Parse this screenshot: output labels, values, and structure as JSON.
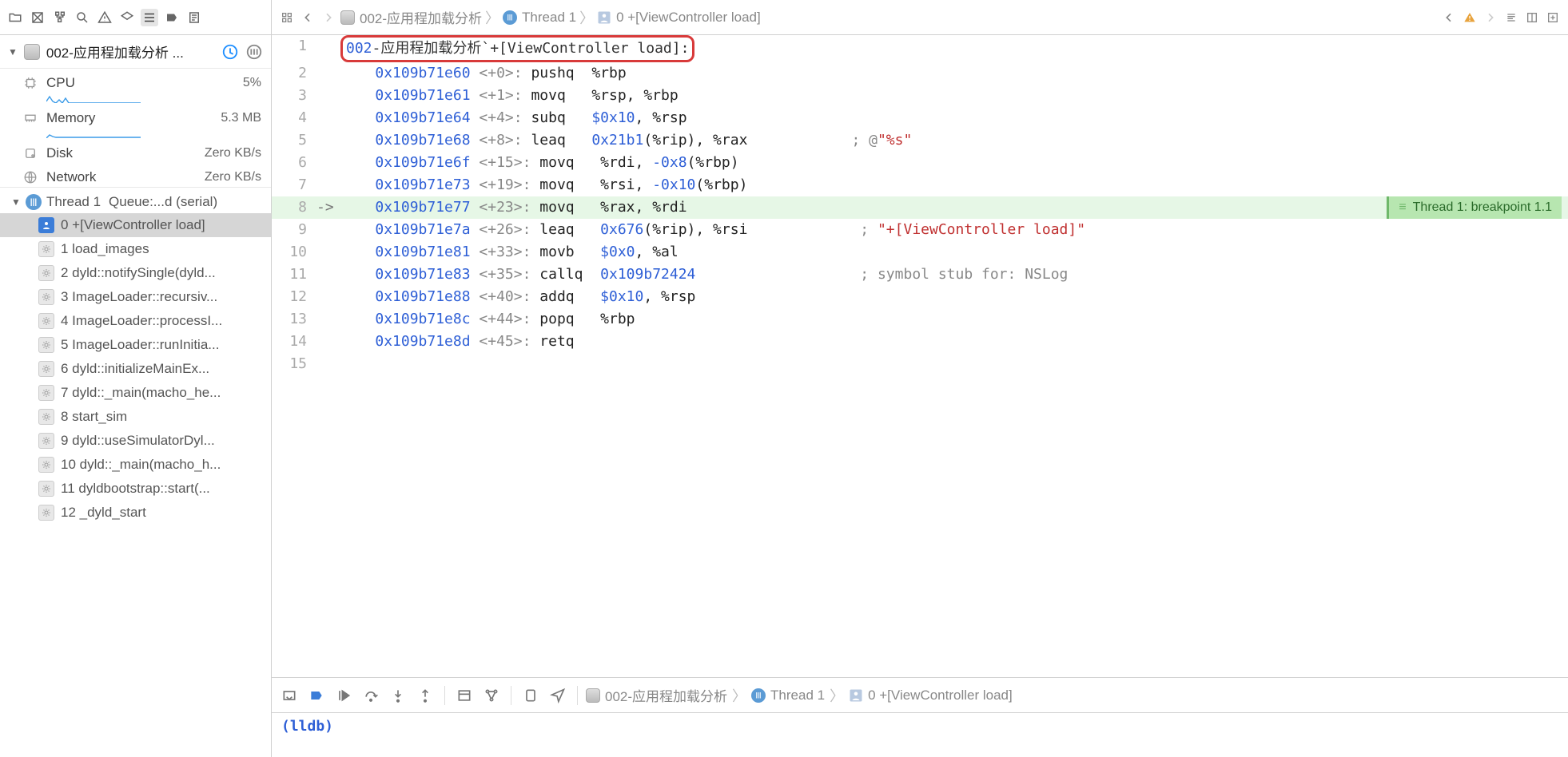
{
  "sidebar": {
    "app_name": "002-应用程加载分析 ...",
    "gauges": {
      "cpu": {
        "label": "CPU",
        "value": "5%"
      },
      "memory": {
        "label": "Memory",
        "value": "5.3 MB"
      },
      "disk": {
        "label": "Disk",
        "value": "Zero KB/s"
      },
      "network": {
        "label": "Network",
        "value": "Zero KB/s"
      }
    },
    "thread": {
      "label": "Thread 1",
      "queue": "Queue:...d (serial)"
    },
    "frames": [
      {
        "n": "0",
        "label": "+[ViewController load]",
        "user": true,
        "selected": true
      },
      {
        "n": "1",
        "label": "load_images"
      },
      {
        "n": "2",
        "label": "dyld::notifySingle(dyld..."
      },
      {
        "n": "3",
        "label": "ImageLoader::recursiv..."
      },
      {
        "n": "4",
        "label": "ImageLoader::processI..."
      },
      {
        "n": "5",
        "label": "ImageLoader::runInitia..."
      },
      {
        "n": "6",
        "label": "dyld::initializeMainEx..."
      },
      {
        "n": "7",
        "label": "dyld::_main(macho_he..."
      },
      {
        "n": "8",
        "label": "start_sim"
      },
      {
        "n": "9",
        "label": "dyld::useSimulatorDyl..."
      },
      {
        "n": "10",
        "label": "dyld::_main(macho_h..."
      },
      {
        "n": "11",
        "label": "dyldbootstrap::start(..."
      },
      {
        "n": "12",
        "label": "_dyld_start"
      }
    ]
  },
  "jumpbar": {
    "seg1": "002-应用程加载分析",
    "seg2": "Thread 1",
    "seg3": "0 +[ViewController load]"
  },
  "editor": {
    "title_app": "002",
    "title_rest": "-应用程加载分析`+[ViewController load]:",
    "bp_annotation": "Thread 1: breakpoint 1.1",
    "lines": [
      {
        "n": 2,
        "addr": "0x109b71e60",
        "off": "<+0>:",
        "mn": "pushq",
        "args": "%rbp"
      },
      {
        "n": 3,
        "addr": "0x109b71e61",
        "off": "<+1>:",
        "mn": "movq",
        "args": "%rsp, %rbp"
      },
      {
        "n": 4,
        "addr": "0x109b71e64",
        "off": "<+4>:",
        "mn": "subq",
        "args_pre": "",
        "imm": "$0x10",
        "args_post": ", %rsp"
      },
      {
        "n": 5,
        "addr": "0x109b71e68",
        "off": "<+8>:",
        "mn": "leaq",
        "args_pre": "",
        "imm": "0x21b1",
        "args_post": "(%rip), %rax",
        "cmt": "; @",
        "str": "\"%s\""
      },
      {
        "n": 6,
        "addr": "0x109b71e6f",
        "off": "<+15>:",
        "mn": "movq",
        "args_pre": "%rdi, ",
        "imm": "-0x8",
        "args_post": "(%rbp)"
      },
      {
        "n": 7,
        "addr": "0x109b71e73",
        "off": "<+19>:",
        "mn": "movq",
        "args_pre": "%rsi, ",
        "imm": "-0x10",
        "args_post": "(%rbp)"
      },
      {
        "n": 8,
        "addr": "0x109b71e77",
        "off": "<+23>:",
        "mn": "movq",
        "args": "%rax, %rdi",
        "current": true
      },
      {
        "n": 9,
        "addr": "0x109b71e7a",
        "off": "<+26>:",
        "mn": "leaq",
        "args_pre": "",
        "imm": "0x676",
        "args_post": "(%rip), %rsi",
        "cmt": "; ",
        "str": "\"+[ViewController load]\""
      },
      {
        "n": 10,
        "addr": "0x109b71e81",
        "off": "<+33>:",
        "mn": "movb",
        "args_pre": "",
        "imm": "$0x0",
        "args_post": ", %al"
      },
      {
        "n": 11,
        "addr": "0x109b71e83",
        "off": "<+35>:",
        "mn": "callq",
        "args_pre": "",
        "addr2": "0x109b72424",
        "cmt": "; symbol stub for: NSLog"
      },
      {
        "n": 12,
        "addr": "0x109b71e88",
        "off": "<+40>:",
        "mn": "addq",
        "args_pre": "",
        "imm": "$0x10",
        "args_post": ", %rsp"
      },
      {
        "n": 13,
        "addr": "0x109b71e8c",
        "off": "<+44>:",
        "mn": "popq",
        "args": "%rbp"
      },
      {
        "n": 14,
        "addr": "0x109b71e8d",
        "off": "<+45>:",
        "mn": "retq",
        "args": ""
      }
    ],
    "blank_line": 15
  },
  "debugbar": {
    "seg1": "002-应用程加载分析",
    "seg2": "Thread 1",
    "seg3": "0 +[ViewController load]"
  },
  "console": {
    "prompt": "(lldb)"
  }
}
